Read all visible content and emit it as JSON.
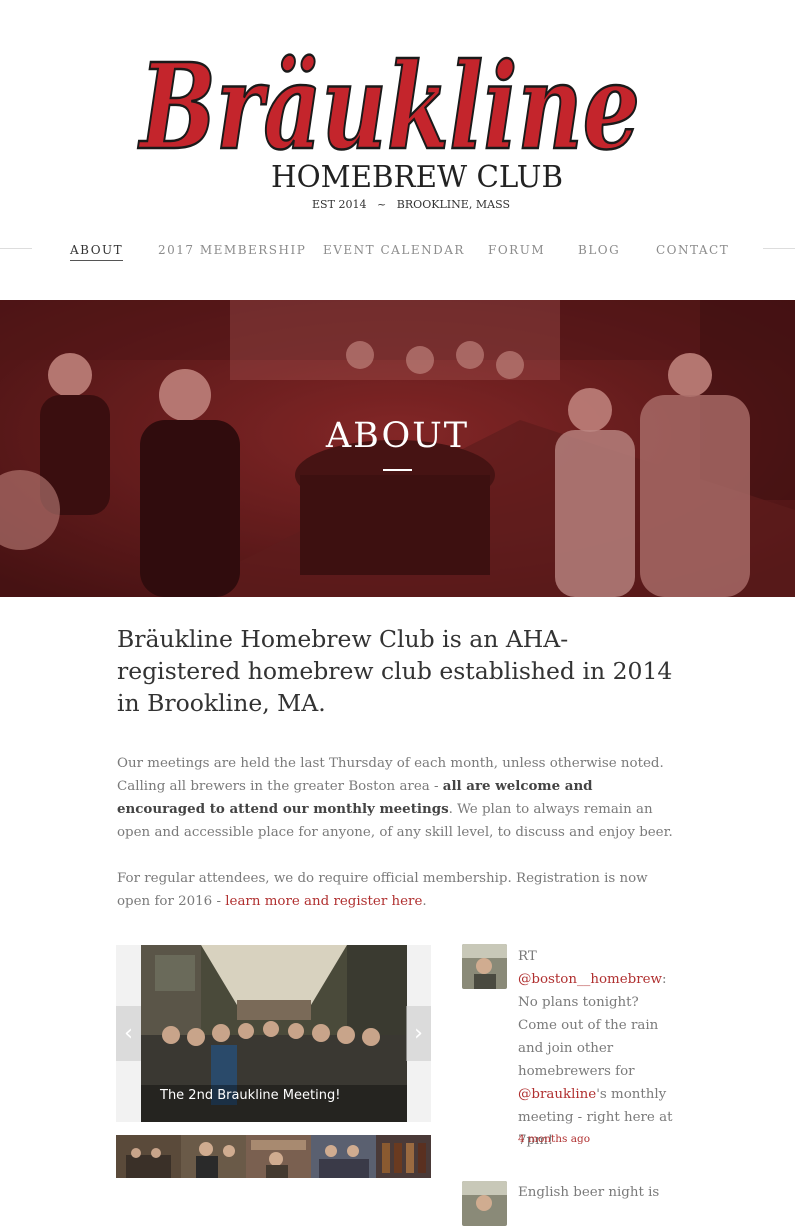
{
  "site": {
    "logo_name": "Bräukline",
    "logo_subtitle": "HOMEBREW CLUB",
    "logo_tagline": "EST 2014   ~   BROOKLINE, MASS"
  },
  "nav": {
    "items": [
      "ABOUT",
      "2017 MEMBERSHIP",
      "EVENT CALENDAR",
      "FORUM",
      "BLOG",
      "CONTACT"
    ],
    "active": "ABOUT"
  },
  "hero": {
    "title": "ABOUT"
  },
  "intro": {
    "lead": "Bräukline Homebrew Club is an AHA-registered homebrew club established in 2014 in Brookline, MA.",
    "p1_a": "Our meetings are held the last Thursday of each month, unless otherwise noted. Calling all brewers in the greater Boston area - ",
    "p1_bold": "all are welcome and encouraged to attend our monthly meetings",
    "p1_b": ". We plan to always remain an open and accessible place for anyone, of any skill level, to discuss and enjoy beer.",
    "p2_a": "For regular attendees, we do require official membership. Registration is now open for 2016 - ",
    "p2_link": "learn more and register here",
    "p2_b": "."
  },
  "slider": {
    "caption": "The 2nd Braukline Meeting!",
    "prev_icon": "‹",
    "next_icon": "›",
    "thumbnail_count": 5
  },
  "tweets": [
    {
      "t1": "RT ",
      "mention1": "@boston__homebrew",
      "t2": ": No plans tonight? Come out of the rain and join other homebrewers for ",
      "mention2": "@braukline",
      "t3": "'s monthly meeting - right here at 7pm!",
      "time": "4 months ago"
    },
    {
      "text": "English beer night is"
    }
  ],
  "colors": {
    "brand_red": "#c4252c",
    "link_red": "#b03030",
    "hero_tint": "#8a2a2a"
  }
}
